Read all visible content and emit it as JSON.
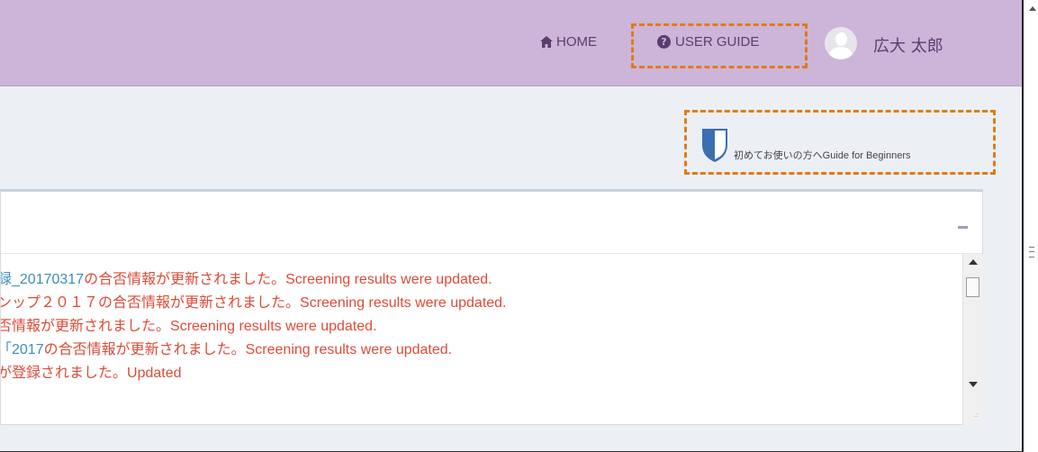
{
  "header": {
    "home_label": "HOME",
    "guide_label": "USER GUIDE",
    "user_name": "広大 太郎",
    "home_icon": "home-icon",
    "guide_icon": "question-circle-icon"
  },
  "beginner": {
    "label_jp": "初めてお使いの方へ",
    "label_en": "Guide for Beginners",
    "icon": "shield-icon"
  },
  "notifications": [
    {
      "prefix": "",
      "link": "録_20170317",
      "jp": "の合否情報が更新されました。",
      "en": "Screening results were updated."
    },
    {
      "prefix": "ンップ２０１７",
      "link": "",
      "jp": "の合否情報が更新されました。",
      "en": "Screening results were updated."
    },
    {
      "prefix": "否情報が更新されました。",
      "link": "",
      "jp": "",
      "en": "Screening results were updated."
    },
    {
      "prefix": "",
      "link": "「2017",
      "jp": "の合否情報が更新されました。",
      "en": "Screening results were updated."
    },
    {
      "prefix": "が登録されました。",
      "link": "",
      "jp": "",
      "en": "Updated"
    }
  ],
  "colors": {
    "header_bg": "#cdb4d9",
    "accent": "#5a3d6d",
    "highlight_border": "#e07b16",
    "message_red": "#dd4b39",
    "link_blue": "#3c8dbc"
  }
}
